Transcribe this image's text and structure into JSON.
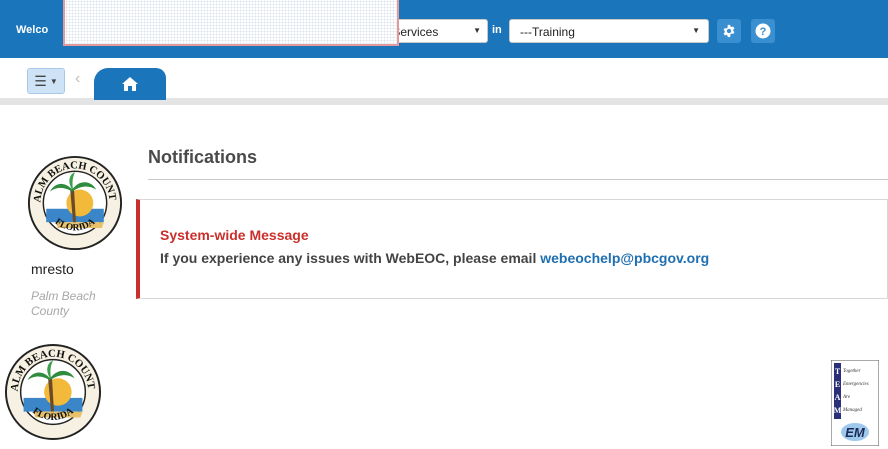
{
  "header": {
    "welcome": "Welco",
    "position_value": "cy Services",
    "in_label": "in",
    "incident_value": "---Training"
  },
  "tabs": {
    "menu_icon": "hamburger-icon",
    "home_icon": "home-icon"
  },
  "profile": {
    "username": "mresto",
    "organization": "Palm Beach County",
    "logo_text_top": "PALM BEACH COUNTY",
    "logo_text_bottom": "FLORIDA"
  },
  "notifications": {
    "title": "Notifications",
    "message_title": "System-wide Message",
    "message_body": "If you experience any issues with WebEOC, please email ",
    "message_link": "webeochelp@pbcgov.org"
  },
  "footer": {
    "team_logo_lines": [
      "Together",
      "Emergencies",
      "Are",
      "Managed",
      "EM"
    ]
  },
  "colors": {
    "brand_blue": "#1a75bb",
    "alert_red": "#c9302c",
    "link_blue": "#1f6fb0"
  }
}
